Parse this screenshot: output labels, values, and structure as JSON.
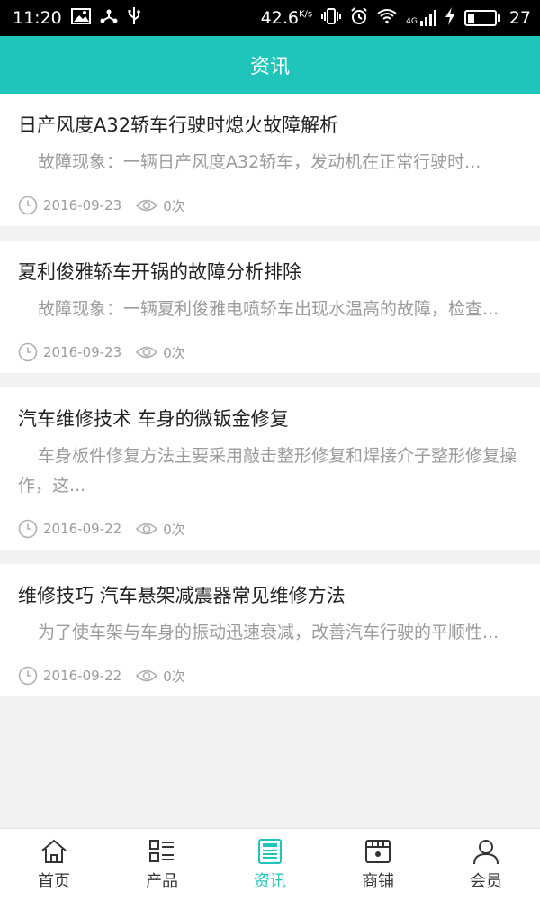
{
  "status_bar": {
    "time": "11:20",
    "net_speed": "42.6",
    "net_unit": "K/s",
    "signal_label": "4G",
    "battery_level": "27"
  },
  "header": {
    "title": "资讯"
  },
  "articles": [
    {
      "title": "日产风度A32轿车行驶时熄火故障解析",
      "summary": "故障现象：一辆日产风度A32轿车，发动机在正常行驶时...",
      "date": "2016-09-23",
      "views": "0次"
    },
    {
      "title": "夏利俊雅轿车开锅的故障分析排除",
      "summary": "故障现象：一辆夏利俊雅电喷轿车出现水温高的故障，检查...",
      "date": "2016-09-23",
      "views": "0次"
    },
    {
      "title": "汽车维修技术 车身的微钣金修复",
      "summary": "车身板件修复方法主要采用敲击整形修复和焊接介子整形修复操作，这...",
      "date": "2016-09-22",
      "views": "0次"
    },
    {
      "title": "维修技巧 汽车悬架减震器常见维修方法",
      "summary": "为了使车架与车身的振动迅速衰减，改善汽车行驶的平顺性...",
      "date": "2016-09-22",
      "views": "0次"
    }
  ],
  "bottom_nav": [
    {
      "label": "首页",
      "icon": "home-icon"
    },
    {
      "label": "产品",
      "icon": "product-list-icon"
    },
    {
      "label": "资讯",
      "icon": "news-icon",
      "active": true
    },
    {
      "label": "商铺",
      "icon": "store-icon"
    },
    {
      "label": "会员",
      "icon": "member-icon"
    }
  ],
  "colors": {
    "accent": "#1fc5ba",
    "text_primary": "#222222",
    "text_secondary": "#9b9b9b"
  }
}
